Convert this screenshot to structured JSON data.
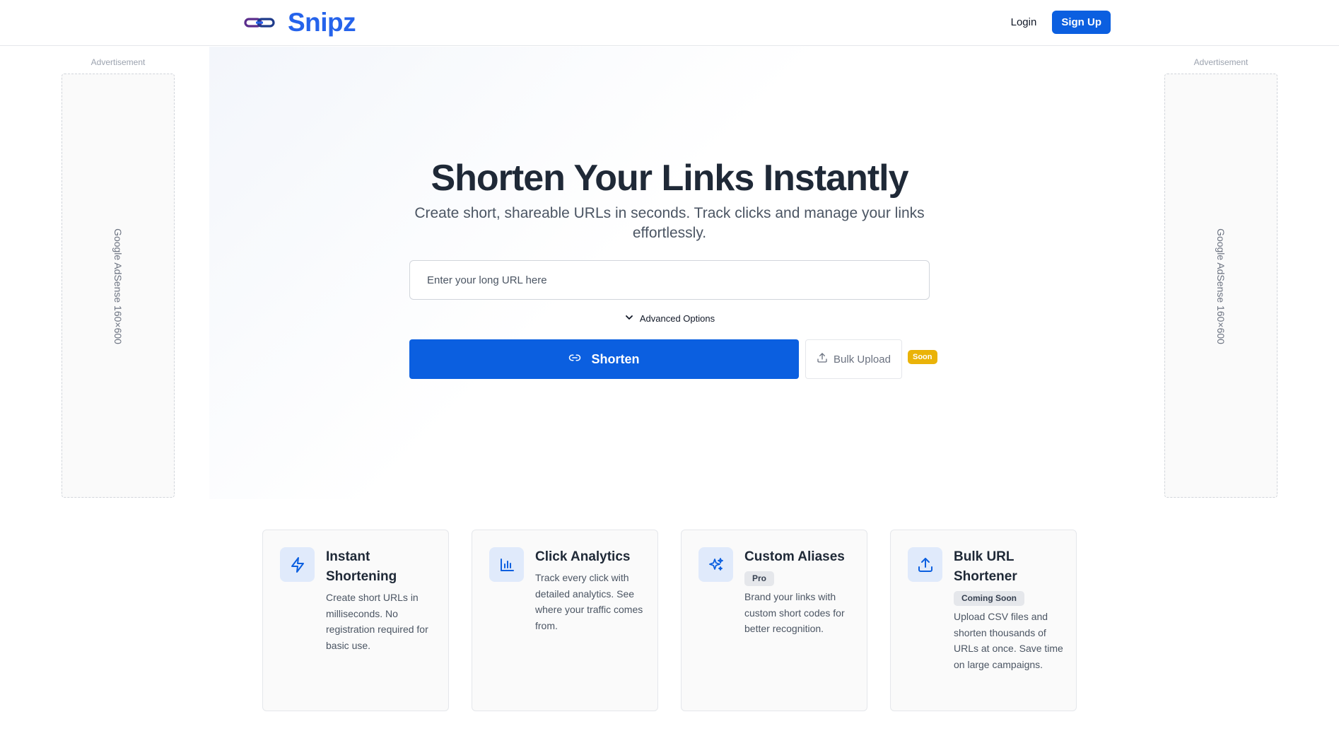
{
  "header": {
    "logo_text": "Snipz",
    "login_label": "Login",
    "signup_label": "Sign Up"
  },
  "ads": {
    "label": "Advertisement",
    "placeholder": "Google AdSense 160×600"
  },
  "hero": {
    "title": "Shorten Your Links Instantly",
    "subtitle": "Create short, shareable URLs in seconds. Track clicks and manage your links effortlessly.",
    "url_placeholder": "Enter your long URL here",
    "url_value": "",
    "advanced_label": "Advanced Options",
    "shorten_label": "Shorten",
    "bulk_label": "Bulk Upload",
    "soon_badge": "Soon"
  },
  "features": [
    {
      "icon": "lightning-icon",
      "title": "Instant Shortening",
      "badge": "",
      "description": "Create short URLs in milliseconds. No registration required for basic use."
    },
    {
      "icon": "bar-chart-icon",
      "title": "Click Analytics",
      "badge": "",
      "description": "Track every click with detailed analytics. See where your traffic comes from."
    },
    {
      "icon": "sparkles-icon",
      "title": "Custom Aliases",
      "badge": "Pro",
      "description": "Brand your links with custom short codes for better recognition."
    },
    {
      "icon": "upload-icon",
      "title": "Bulk URL Shortener",
      "badge": "Coming Soon",
      "description": "Upload CSV files and shorten thousands of URLs at once. Save time on large campaigns."
    }
  ],
  "colors": {
    "primary": "#0b5fe0",
    "logo": "#2563eb",
    "soon_badge": "#eab308",
    "icon_bg": "#e0eafb"
  }
}
